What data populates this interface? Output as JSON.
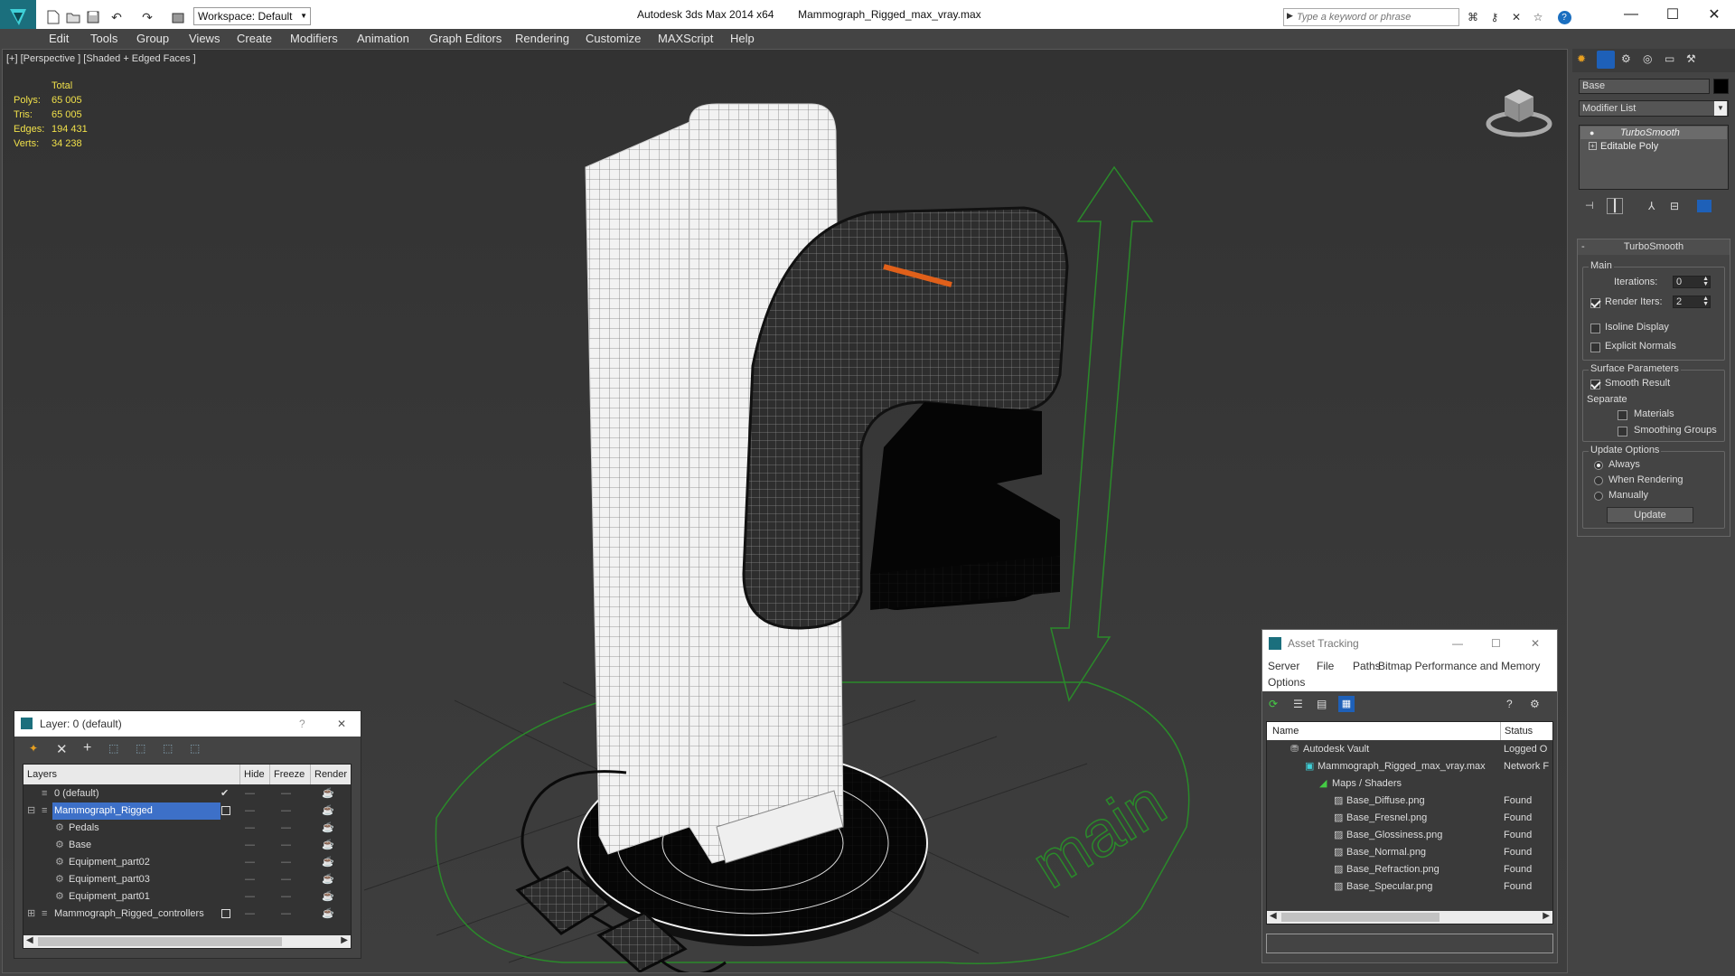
{
  "app": {
    "title": "Autodesk 3ds Max  2014 x64",
    "file": "Mammograph_Rigged_max_vray.max",
    "workspace": "Workspace: Default",
    "search_placeholder": "Type a keyword or phrase"
  },
  "menu": [
    "Edit",
    "Tools",
    "Group",
    "Views",
    "Create",
    "Modifiers",
    "Animation",
    "Graph Editors",
    "Rendering",
    "Customize",
    "MAXScript",
    "Help"
  ],
  "viewport": {
    "label": "[+] [Perspective ] [Shaded + Edged Faces ]",
    "stats": {
      "header": "Total",
      "rows": [
        {
          "label": "Polys:",
          "value": "65 005"
        },
        {
          "label": "Tris:",
          "value": "65 005"
        },
        {
          "label": "Edges:",
          "value": "194 431"
        },
        {
          "label": "Verts:",
          "value": "34 238"
        }
      ]
    },
    "floor_text": "main"
  },
  "layer_panel": {
    "title": "Layer: 0 (default)",
    "help": "?",
    "close": "✕",
    "columns": [
      "Layers",
      "Hide",
      "Freeze",
      "Render"
    ],
    "rows": [
      {
        "name": "0 (default)",
        "level": 0,
        "current": true,
        "selected": false
      },
      {
        "name": "Mammograph_Rigged",
        "level": 0,
        "current": false,
        "selected": true
      },
      {
        "name": "Pedals",
        "level": 1,
        "current": false,
        "selected": false
      },
      {
        "name": "Base",
        "level": 1,
        "current": false,
        "selected": false
      },
      {
        "name": "Equipment_part02",
        "level": 1,
        "current": false,
        "selected": false
      },
      {
        "name": "Equipment_part03",
        "level": 1,
        "current": false,
        "selected": false
      },
      {
        "name": "Equipment_part01",
        "level": 1,
        "current": false,
        "selected": false
      },
      {
        "name": "Mammograph_Rigged_controllers",
        "level": 0,
        "current": false,
        "selected": false
      }
    ]
  },
  "asset_tracking": {
    "title": "Asset Tracking",
    "menu": [
      "Server",
      "File",
      "Paths",
      "Bitmap Performance and Memory",
      "Options"
    ],
    "columns": [
      "Name",
      "Status"
    ],
    "rows": [
      {
        "name": "Autodesk Vault",
        "status": "Logged O",
        "indent": 1
      },
      {
        "name": "Mammograph_Rigged_max_vray.max",
        "status": "Network F",
        "indent": 2
      },
      {
        "name": "Maps / Shaders",
        "status": "",
        "indent": 3
      },
      {
        "name": "Base_Diffuse.png",
        "status": "Found",
        "indent": 4
      },
      {
        "name": "Base_Fresnel.png",
        "status": "Found",
        "indent": 4
      },
      {
        "name": "Base_Glossiness.png",
        "status": "Found",
        "indent": 4
      },
      {
        "name": "Base_Normal.png",
        "status": "Found",
        "indent": 4
      },
      {
        "name": "Base_Refraction.png",
        "status": "Found",
        "indent": 4
      },
      {
        "name": "Base_Specular.png",
        "status": "Found",
        "indent": 4
      }
    ]
  },
  "command_panel": {
    "object_name": "Base",
    "modifier_list": "Modifier List",
    "stack": [
      "TurboSmooth",
      "Editable Poly"
    ],
    "rollout_title": "TurboSmooth",
    "main_group": "Main",
    "iterations_label": "Iterations:",
    "iterations_value": "0",
    "render_iters_label": "Render Iters:",
    "render_iters_value": "2",
    "render_iters_checked": true,
    "isoline_label": "Isoline Display",
    "explicit_normals_label": "Explicit Normals",
    "surface_group": "Surface Parameters",
    "smooth_result_label": "Smooth Result",
    "separate_label": "Separate",
    "materials_label": "Materials",
    "smoothing_groups_label": "Smoothing Groups",
    "update_group": "Update Options",
    "update_options": [
      {
        "label": "Always",
        "selected": true
      },
      {
        "label": "When Rendering",
        "selected": false
      },
      {
        "label": "Manually",
        "selected": false
      }
    ],
    "update_button": "Update"
  },
  "colors": {
    "accent": "#1e90ff",
    "selection": "#3d70c8",
    "grid_green": "#2a8a2a",
    "orange": "#e0601a"
  }
}
